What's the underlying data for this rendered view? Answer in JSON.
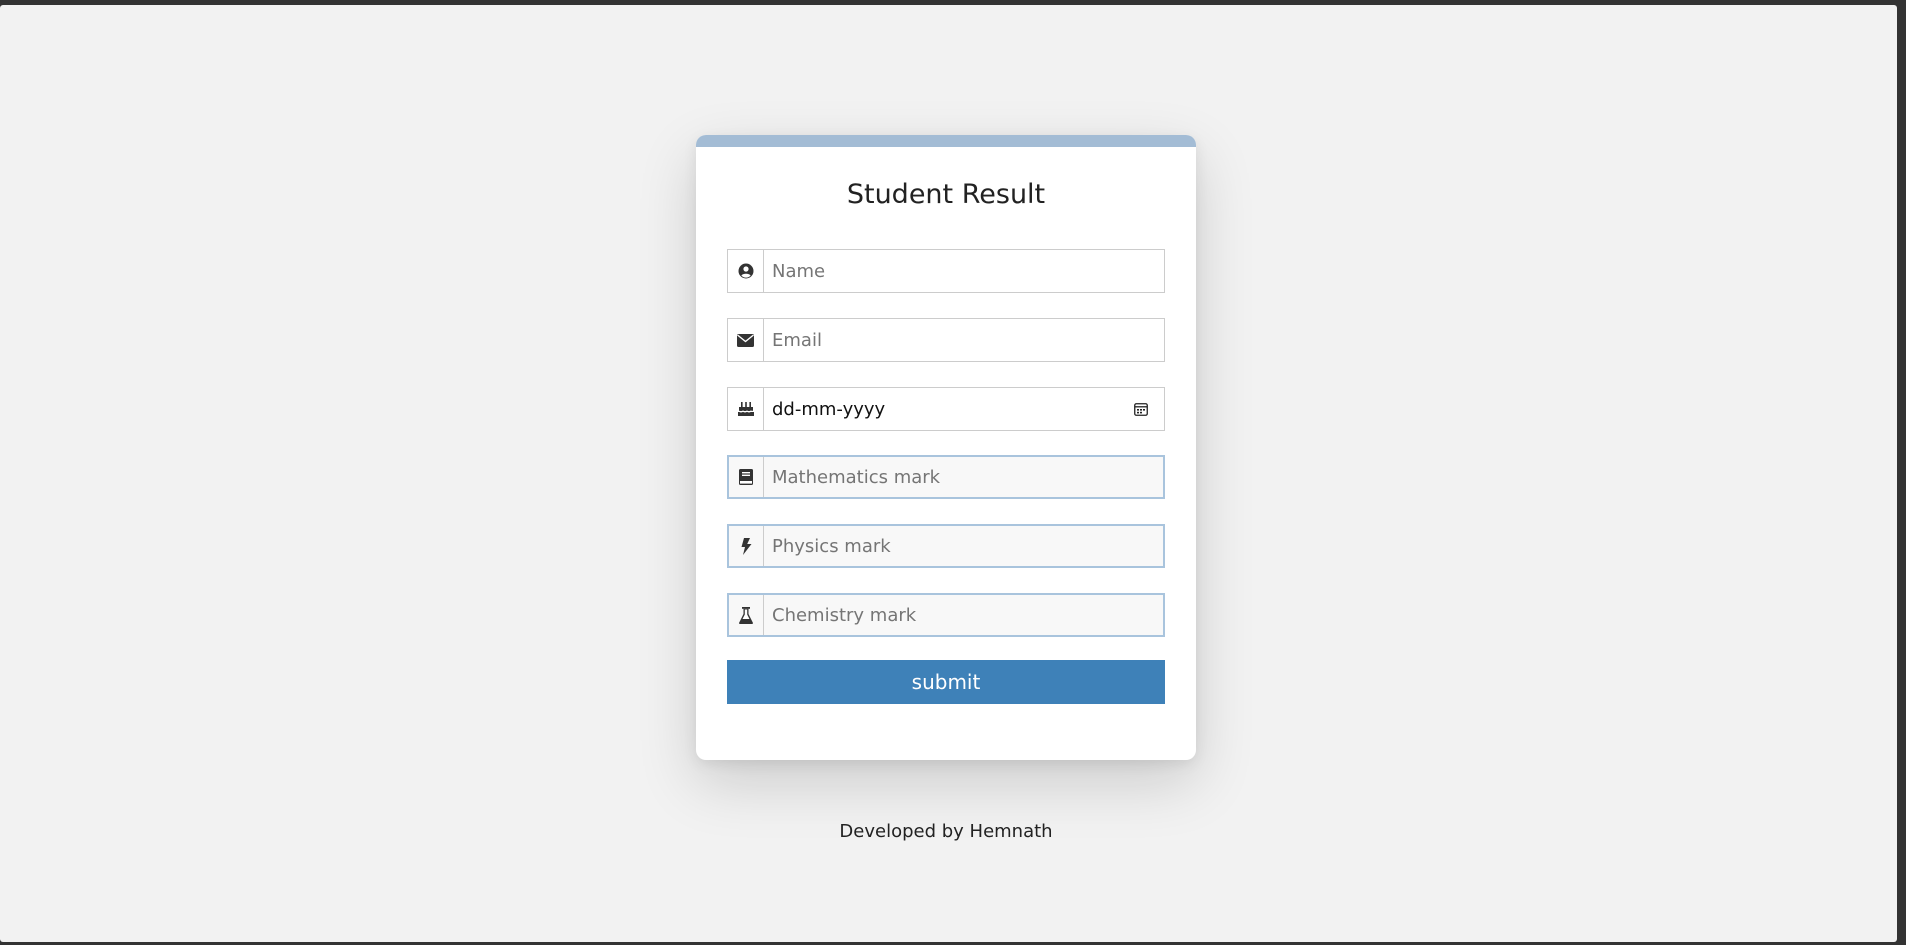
{
  "form": {
    "title": "Student Result",
    "name_placeholder": "Name",
    "email_placeholder": "Email",
    "dob_value": "dd-mm-yyyy",
    "math_placeholder": "Mathematics mark",
    "physics_placeholder": "Physics mark",
    "chemistry_placeholder": "Chemistry mark",
    "submit_label": "submit"
  },
  "footer": {
    "text": "Developed by Hemnath"
  },
  "icons": {
    "name": "user-circle-icon",
    "email": "envelope-icon",
    "dob": "birthday-cake-icon",
    "date_picker": "calendar-icon",
    "math": "book-icon",
    "physics": "bolt-icon",
    "chemistry": "flask-icon"
  },
  "colors": {
    "accent": "#3e81b8",
    "card_topbar": "#a3bcd5",
    "page_background": "#f2f2f2"
  }
}
